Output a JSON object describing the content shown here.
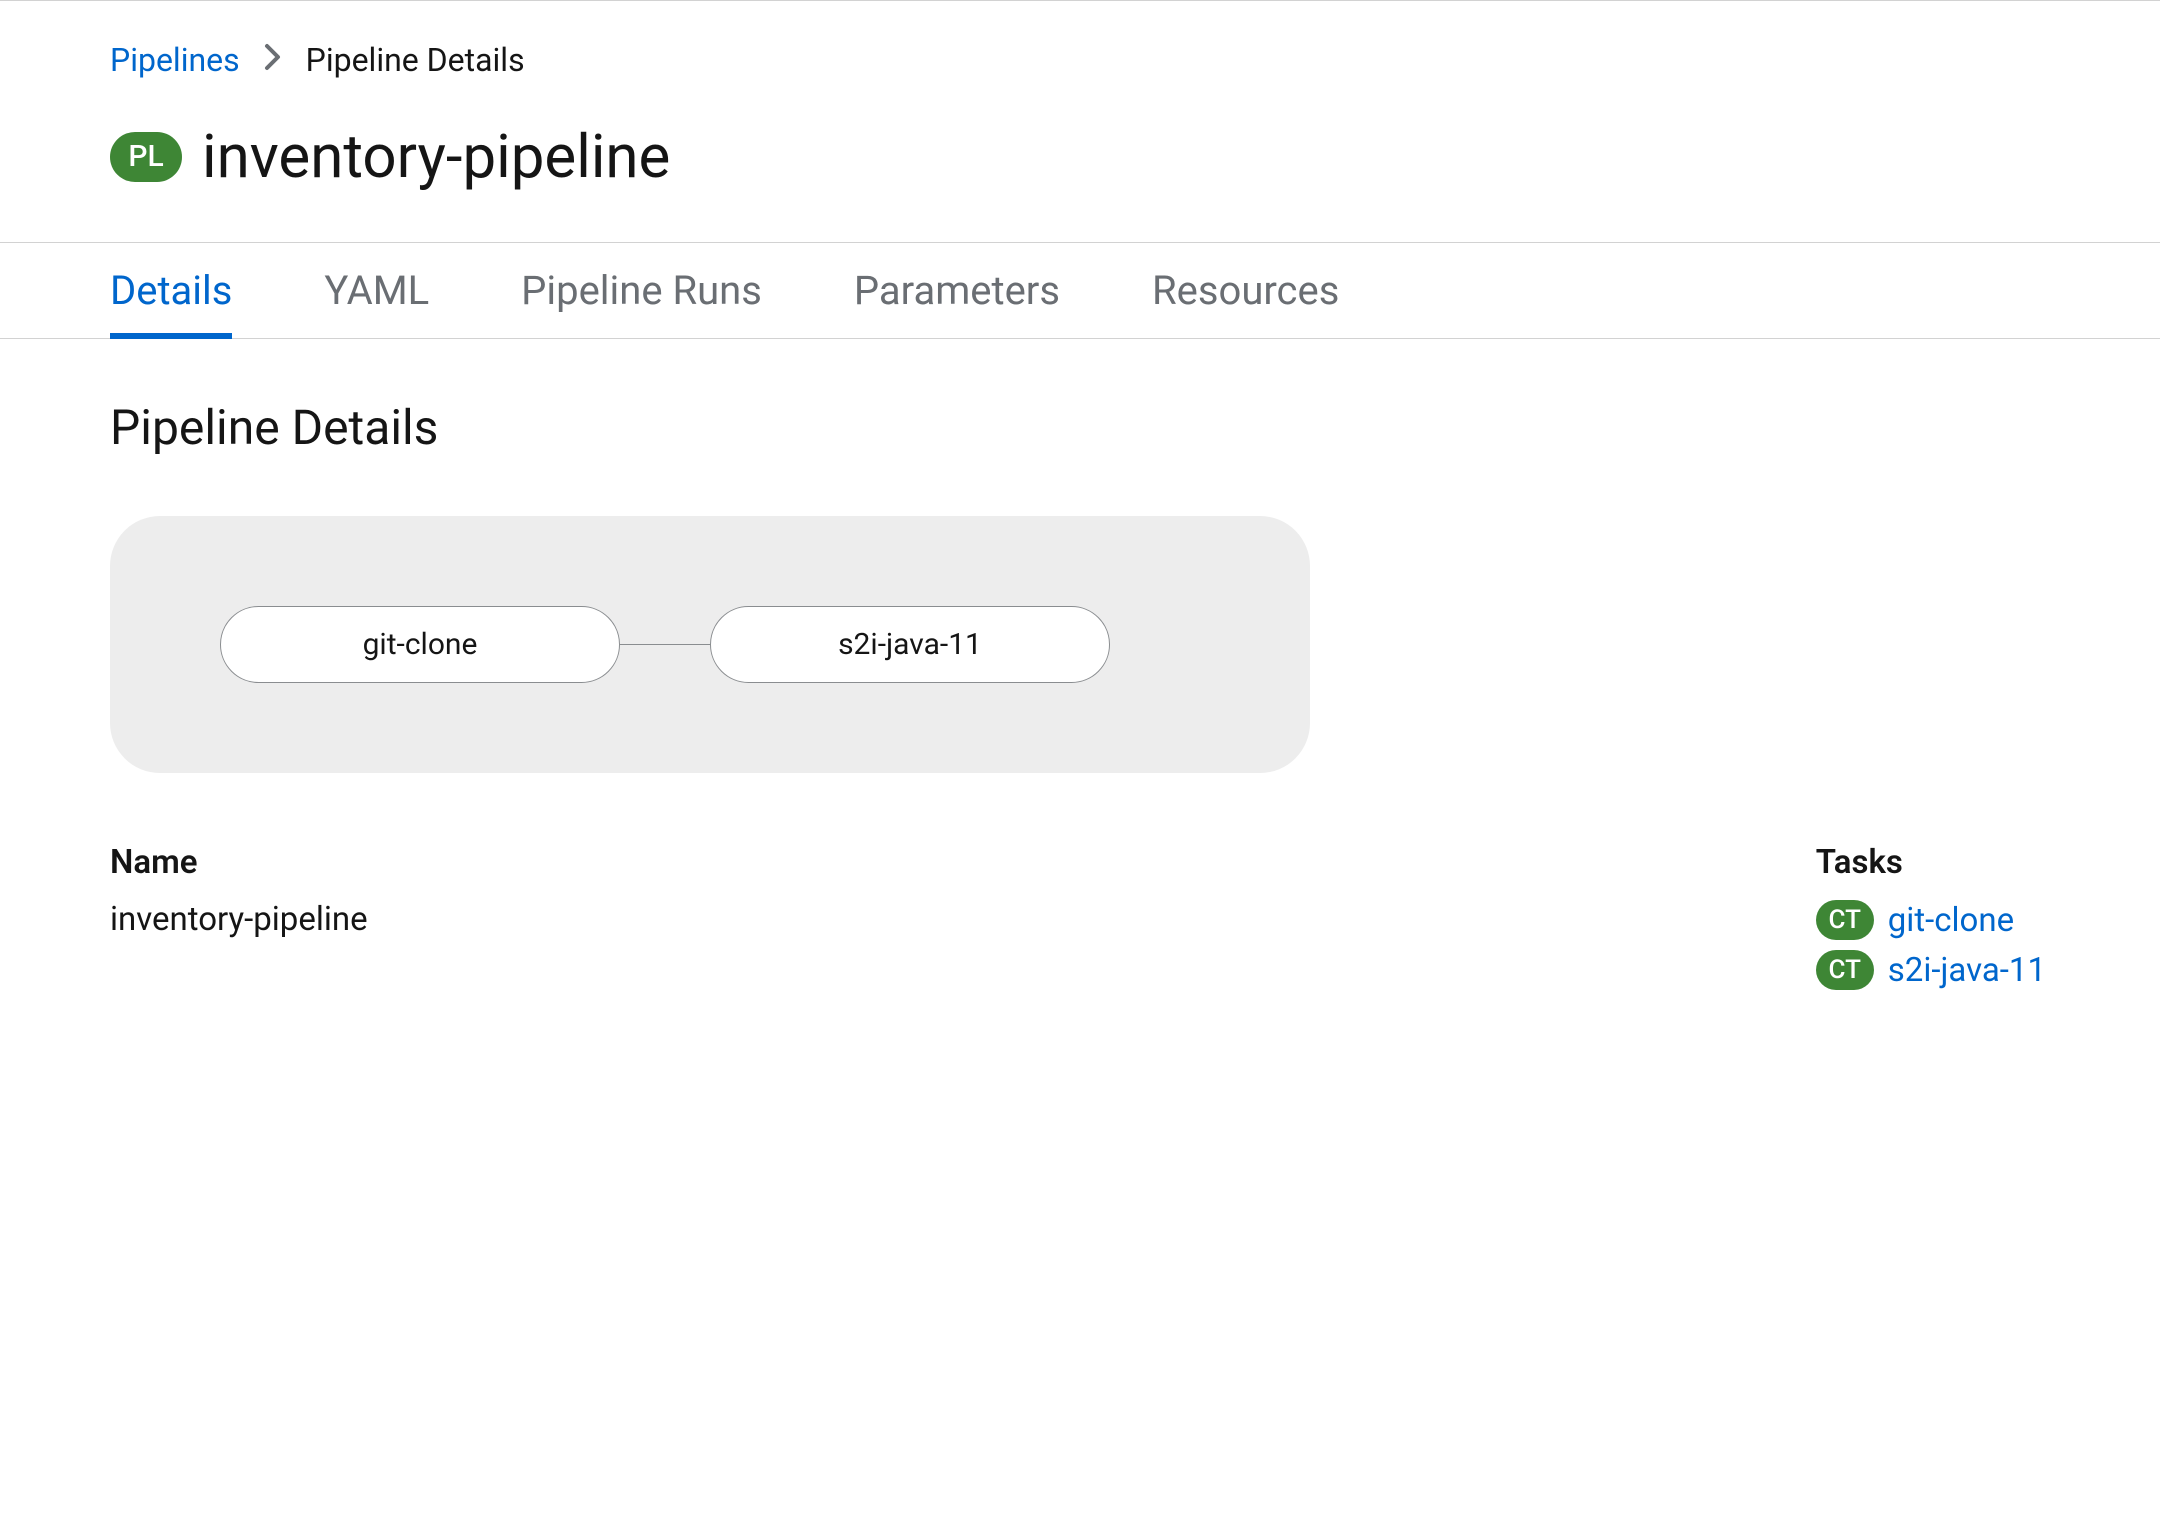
{
  "breadcrumb": {
    "parentLabel": "Pipelines",
    "currentLabel": "Pipeline Details"
  },
  "header": {
    "badgeText": "PL",
    "title": "inventory-pipeline"
  },
  "tabs": [
    {
      "label": "Details",
      "active": true
    },
    {
      "label": "YAML",
      "active": false
    },
    {
      "label": "Pipeline Runs",
      "active": false
    },
    {
      "label": "Parameters",
      "active": false
    },
    {
      "label": "Resources",
      "active": false
    }
  ],
  "sectionTitle": "Pipeline Details",
  "diagram": {
    "node1": "git-clone",
    "node2": "s2i-java-11"
  },
  "details": {
    "nameLabel": "Name",
    "nameValue": "inventory-pipeline",
    "tasksLabel": "Tasks",
    "tasks": [
      {
        "badge": "CT",
        "label": "git-clone"
      },
      {
        "badge": "CT",
        "label": "s2i-java-11"
      }
    ]
  }
}
